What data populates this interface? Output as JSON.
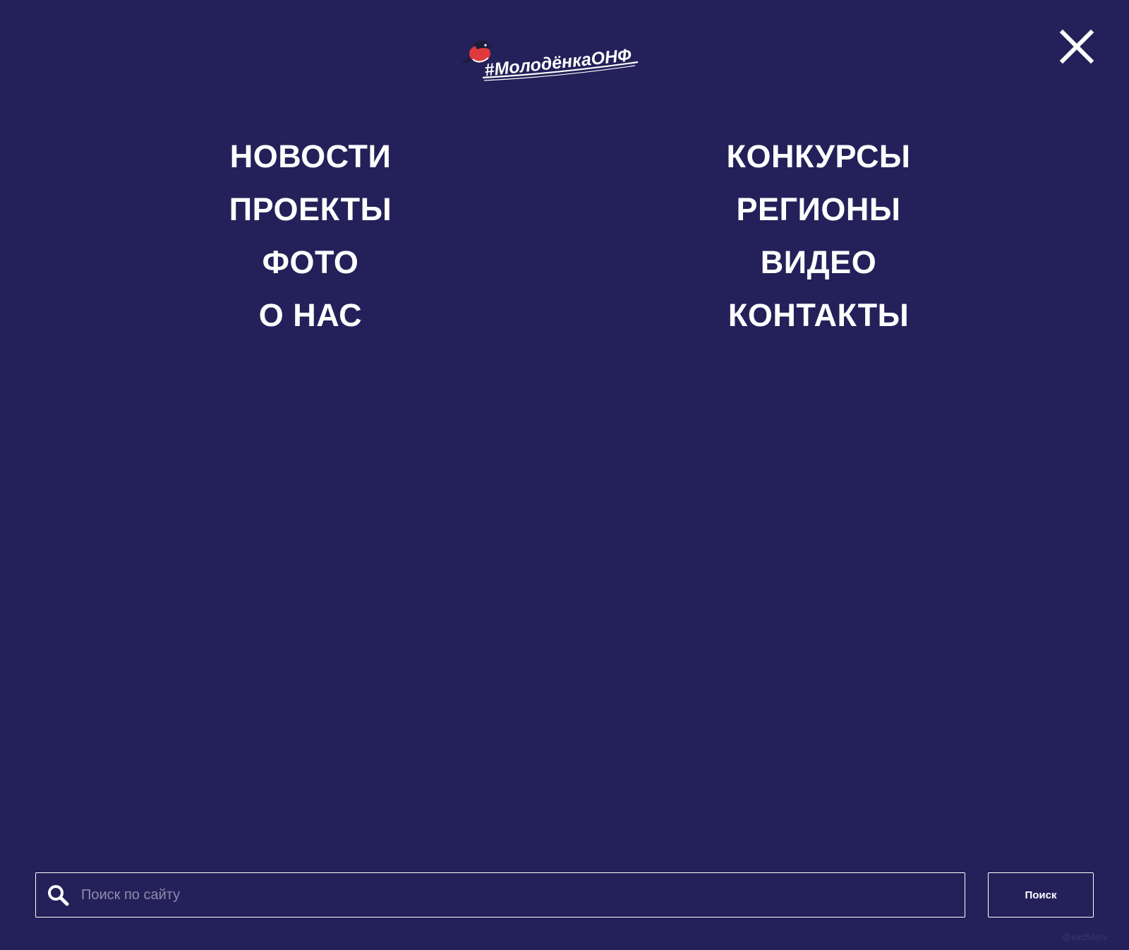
{
  "header": {
    "logo_text": "#МолодёнкаОНФ",
    "close_icon": "close-icon"
  },
  "nav": {
    "left": [
      {
        "label": "НОВОСТИ"
      },
      {
        "label": "ПРОЕКТЫ"
      },
      {
        "label": "ФОТО"
      },
      {
        "label": "О НАС"
      }
    ],
    "right": [
      {
        "label": "КОНКУРСЫ"
      },
      {
        "label": "РЕГИОНЫ"
      },
      {
        "label": "ВИДЕО"
      },
      {
        "label": "КОНТАКТЫ"
      }
    ]
  },
  "search": {
    "icon": "search-icon",
    "placeholder": "Поиск по сайту",
    "value": "",
    "button_label": "Поиск"
  },
  "watermark": "@evc54/cv",
  "colors": {
    "background": "#242059",
    "text": "#ffffff",
    "placeholder": "#8f8cab",
    "bird_red": "#e0393e"
  }
}
